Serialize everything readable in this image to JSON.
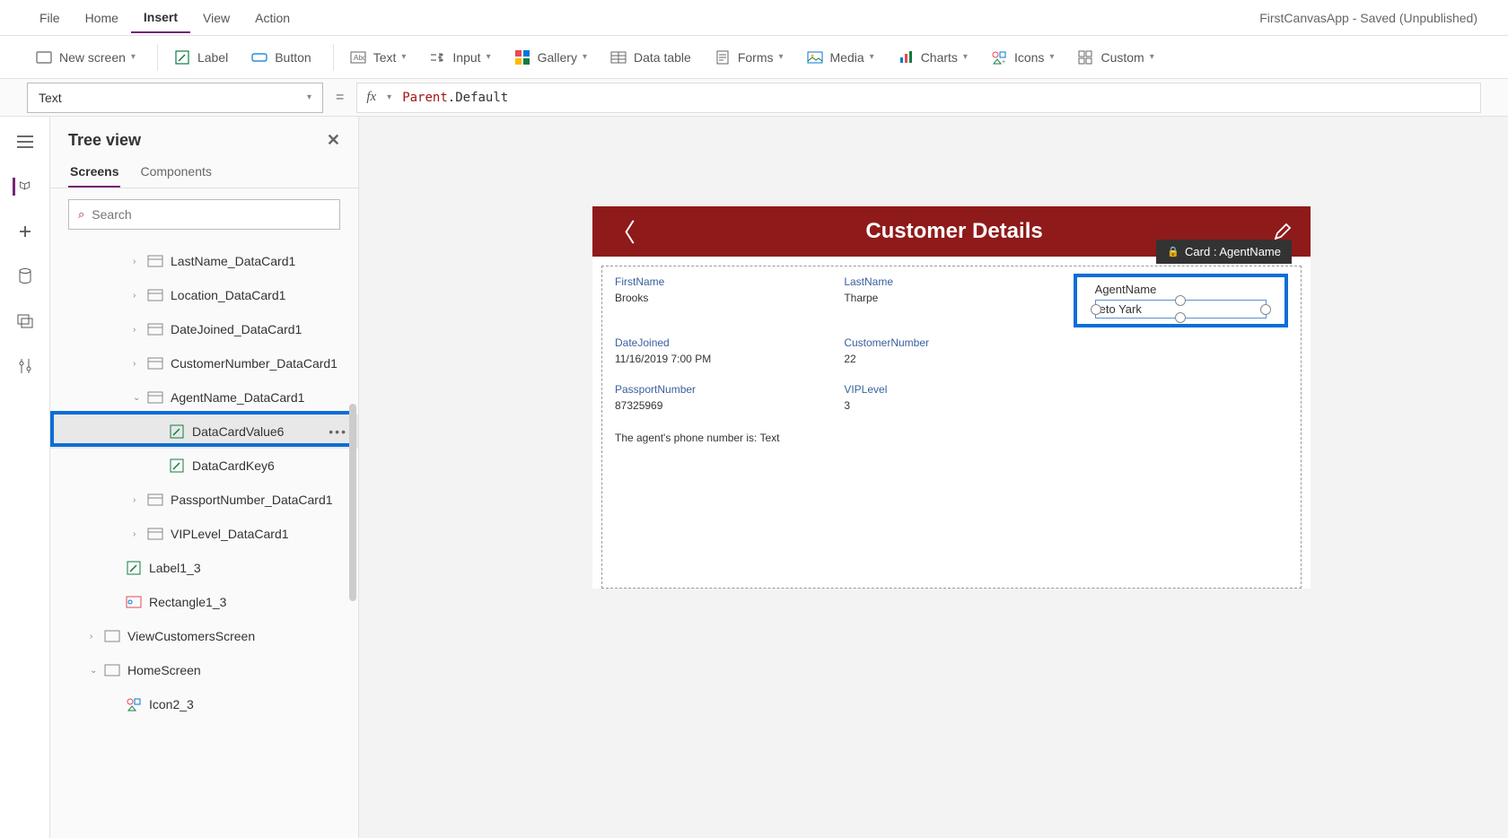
{
  "app_title": "FirstCanvasApp - Saved (Unpublished)",
  "menu": {
    "file": "File",
    "home": "Home",
    "insert": "Insert",
    "view": "View",
    "action": "Action"
  },
  "ribbon": {
    "new_screen": "New screen",
    "label": "Label",
    "button": "Button",
    "text": "Text",
    "input": "Input",
    "gallery": "Gallery",
    "data_table": "Data table",
    "forms": "Forms",
    "media": "Media",
    "charts": "Charts",
    "icons": "Icons",
    "custom": "Custom"
  },
  "formula": {
    "property": "Text",
    "parent": "Parent",
    "rest": ".Default"
  },
  "side": {
    "title": "Tree view",
    "tabs": {
      "screens": "Screens",
      "components": "Components"
    },
    "search_placeholder": "Search",
    "items": [
      {
        "label": "LastName_DataCard1",
        "indent": 3,
        "chev": ">",
        "icon": "card"
      },
      {
        "label": "Location_DataCard1",
        "indent": 3,
        "chev": ">",
        "icon": "card"
      },
      {
        "label": "DateJoined_DataCard1",
        "indent": 3,
        "chev": ">",
        "icon": "card"
      },
      {
        "label": "CustomerNumber_DataCard1",
        "indent": 3,
        "chev": ">",
        "icon": "card"
      },
      {
        "label": "AgentName_DataCard1",
        "indent": 3,
        "chev": "v",
        "icon": "card"
      },
      {
        "label": "DataCardValue6",
        "indent": 4,
        "chev": "",
        "icon": "label",
        "selected": true,
        "more": true
      },
      {
        "label": "DataCardKey6",
        "indent": 4,
        "chev": "",
        "icon": "label"
      },
      {
        "label": "PassportNumber_DataCard1",
        "indent": 3,
        "chev": ">",
        "icon": "card"
      },
      {
        "label": "VIPLevel_DataCard1",
        "indent": 3,
        "chev": ">",
        "icon": "card"
      },
      {
        "label": "Label1_3",
        "indent": 2,
        "chev": "",
        "icon": "label"
      },
      {
        "label": "Rectangle1_3",
        "indent": 2,
        "chev": "",
        "icon": "rect"
      },
      {
        "label": "ViewCustomersScreen",
        "indent": 1,
        "chev": ">",
        "icon": "screen"
      },
      {
        "label": "HomeScreen",
        "indent": 1,
        "chev": "v",
        "icon": "screen"
      },
      {
        "label": "Icon2_3",
        "indent": 2,
        "chev": "",
        "icon": "icon"
      }
    ]
  },
  "canvas": {
    "title": "Customer Details",
    "card_tag": "Card : AgentName",
    "cards": {
      "firstname_l": "FirstName",
      "firstname_v": "Brooks",
      "lastname_l": "LastName",
      "lastname_v": "Tharpe",
      "datejoined_l": "DateJoined",
      "datejoined_v": "11/16/2019 7:00 PM",
      "custnum_l": "CustomerNumber",
      "custnum_v": "22",
      "passport_l": "PassportNumber",
      "passport_v": "87325969",
      "vip_l": "VIPLevel",
      "vip_v": "3",
      "agent_l": "AgentName",
      "agent_v": "eto Yark"
    },
    "footer": "The agent's phone number is:   Text"
  }
}
